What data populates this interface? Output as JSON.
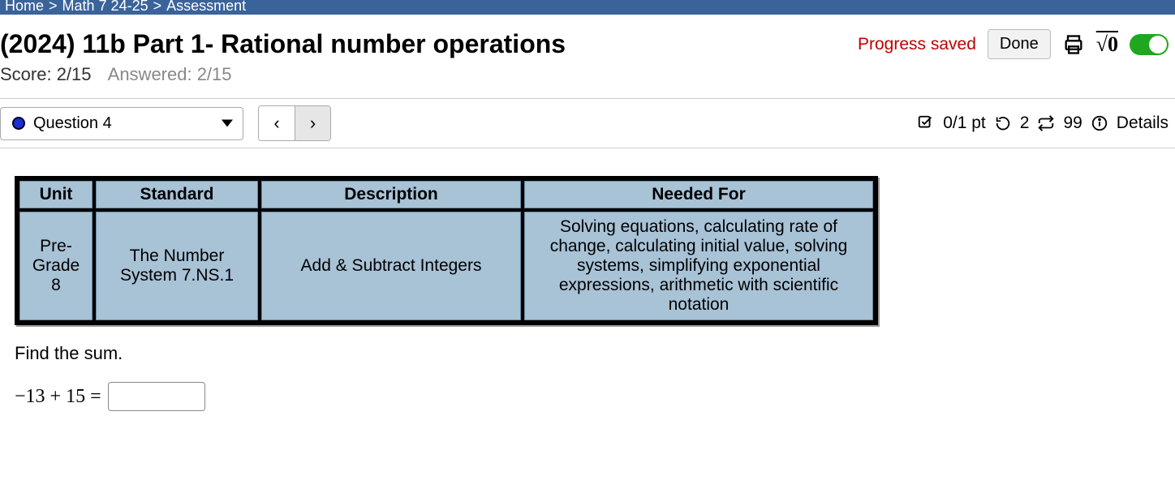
{
  "breadcrumb": {
    "home": "Home",
    "course": "Math 7 24-25",
    "page": "Assessment"
  },
  "header": {
    "title": "(2024) 11b Part 1- Rational number operations",
    "progress_saved": "Progress saved",
    "done_label": "Done",
    "sqrt_label": "√0"
  },
  "score": {
    "score_label": "Score: 2/15",
    "answered_label": "Answered: 2/15"
  },
  "question_bar": {
    "current": "Question 4",
    "points_label": "0/1 pt",
    "tries": "2",
    "attempts": "99",
    "details_label": "Details"
  },
  "table": {
    "headers": {
      "unit": "Unit",
      "standard": "Standard",
      "description": "Description",
      "needed": "Needed For"
    },
    "row": {
      "unit": "Pre-Grade 8",
      "standard": "The Number System 7.NS.1",
      "description": "Add & Subtract Integers",
      "needed": "Solving equations, calculating rate of change, calculating initial value, solving systems, simplifying exponential expressions, arithmetic with scientific notation"
    }
  },
  "problem": {
    "prompt": "Find the sum.",
    "expression": "−13 + 15 ="
  },
  "chart_data": {
    "type": "table",
    "columns": [
      "Unit",
      "Standard",
      "Description",
      "Needed For"
    ],
    "rows": [
      [
        "Pre-Grade 8",
        "The Number System 7.NS.1",
        "Add & Subtract Integers",
        "Solving equations, calculating rate of change, calculating initial value, solving systems, simplifying exponential expressions, arithmetic with scientific notation"
      ]
    ]
  }
}
